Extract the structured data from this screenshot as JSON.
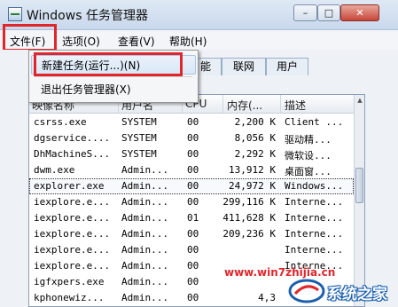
{
  "window": {
    "title": "Windows 任务管理器",
    "controls": {
      "minimize": "–",
      "maximize": "□",
      "close": "✕"
    }
  },
  "menu": [
    "文件(F)",
    "选项(O)",
    "查看(V)",
    "帮助(H)"
  ],
  "file_menu": {
    "items": [
      "新建任务(运行...)(N)",
      "退出任务管理器(X)"
    ],
    "highlighted": "新建任务(运行...)(N)"
  },
  "tabs": [
    "能",
    "联网",
    "用户"
  ],
  "table": {
    "columns": [
      "映像名称",
      "用户名",
      "CPU",
      "内存(...",
      "描述"
    ],
    "rows": [
      [
        "csrss.exe",
        "SYSTEM",
        "00",
        "2,200 K",
        "Client ..."
      ],
      [
        "dgservice....",
        "SYSTEM",
        "00",
        "8,056 K",
        "驱动精..."
      ],
      [
        "DhMachineS...",
        "SYSTEM",
        "00",
        "2,292 K",
        "微软设..."
      ],
      [
        "dwm.exe",
        "Admin...",
        "00",
        "13,912 K",
        "桌面窗..."
      ],
      [
        "explorer.exe",
        "Admin...",
        "00",
        "24,972 K",
        "Windows..."
      ],
      [
        "iexplore.e...",
        "Admin...",
        "00",
        "299,116 K",
        "Interne..."
      ],
      [
        "iexplore.e...",
        "Admin...",
        "01",
        "411,628 K",
        "Interne..."
      ],
      [
        "iexplore.e...",
        "Admin...",
        "00",
        "209,236 K",
        "Interne..."
      ],
      [
        "iexplore.e...",
        "Admin...",
        "00",
        "",
        "Interne..."
      ],
      [
        "iexplore.e...",
        "Admin...",
        "00",
        "",
        "Interne..."
      ],
      [
        "igfxpers.exe",
        "Admin...",
        "00",
        "",
        ""
      ],
      [
        "kphonewiz...",
        "Admin...",
        "00",
        "4,3",
        ""
      ]
    ],
    "selected_row": "explorer.exe"
  },
  "watermark": "www.win7zhijia.cn",
  "logo": {
    "text": "系统之家",
    "icon": "system-home-logo-icon"
  },
  "colors": {
    "highlight": "#e0262a",
    "titlebar": "#c9d8ec"
  }
}
